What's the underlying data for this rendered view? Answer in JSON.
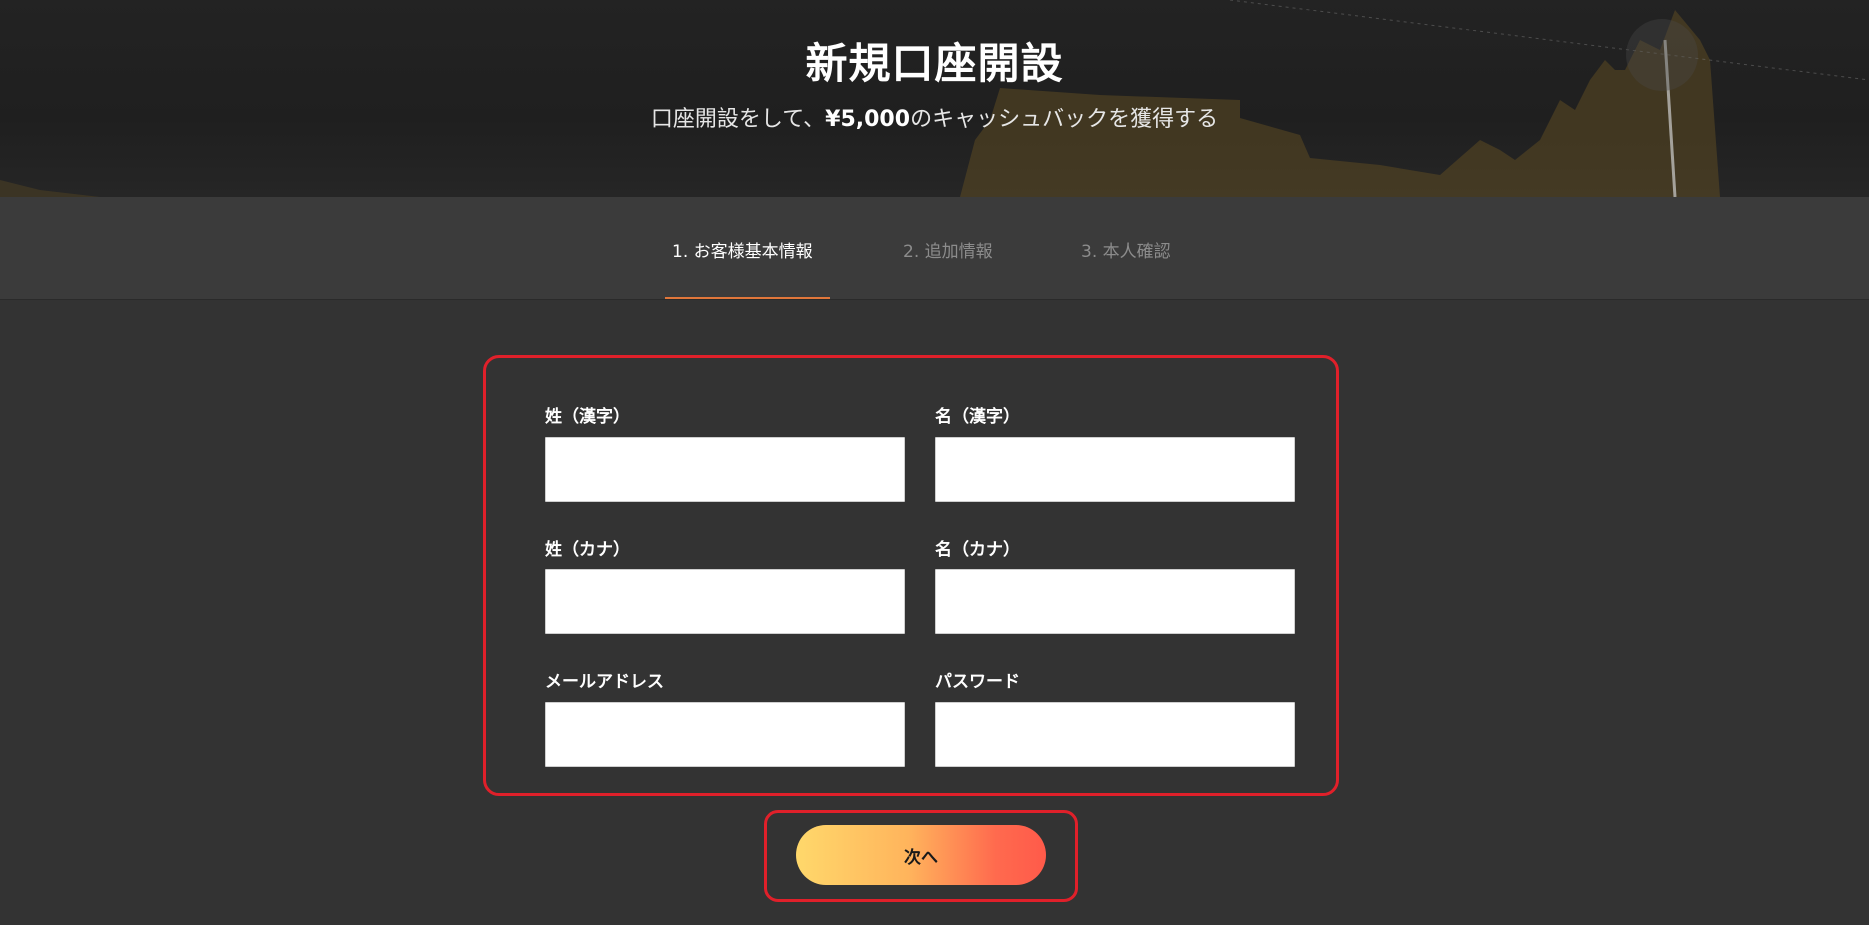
{
  "hero": {
    "title": "新規口座開設",
    "subtitle_pre": "口座開設をして、",
    "subtitle_amount": "¥5,000",
    "subtitle_post": "のキャッシュバックを獲得する"
  },
  "tabs": [
    {
      "label": "1. お客様基本情報",
      "active": true
    },
    {
      "label": "2. 追加情報",
      "active": false
    },
    {
      "label": "3. 本人確認",
      "active": false
    }
  ],
  "form": {
    "fields": [
      {
        "label": "姓（漢字）",
        "value": ""
      },
      {
        "label": "名（漢字）",
        "value": ""
      },
      {
        "label": "姓（カナ）",
        "value": ""
      },
      {
        "label": "名（カナ）",
        "value": ""
      },
      {
        "label": "メールアドレス",
        "value": ""
      },
      {
        "label": "パスワード",
        "value": ""
      }
    ]
  },
  "next_button": {
    "label": "次へ"
  },
  "colors": {
    "accent_tab_underline": "#e0763a",
    "highlight_border": "#e0202a",
    "button_gradient_start": "#ffd86b",
    "button_gradient_end": "#ff5a4a"
  }
}
